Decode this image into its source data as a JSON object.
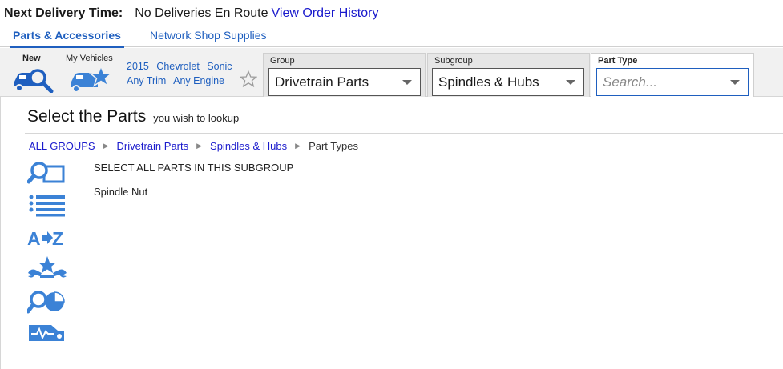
{
  "delivery": {
    "label": "Next Delivery Time:",
    "status": "No Deliveries En Route",
    "history_link": "View Order History"
  },
  "tabs": [
    {
      "label": "Parts & Accessories",
      "active": true
    },
    {
      "label": "Network Shop Supplies",
      "active": false
    }
  ],
  "toolbar": {
    "new_label": "New",
    "my_vehicles_label": "My Vehicles",
    "vehicle": {
      "year": "2015",
      "make": "Chevrolet",
      "model": "Sonic",
      "trim": "Any Trim",
      "engine": "Any Engine"
    },
    "group": {
      "label": "Group",
      "value": "Drivetrain Parts"
    },
    "subgroup": {
      "label": "Subgroup",
      "value": "Spindles & Hubs"
    },
    "part_type": {
      "label": "Part Type",
      "placeholder": "Search..."
    }
  },
  "main": {
    "title": "Select the Parts",
    "subtitle": "you wish to lookup",
    "breadcrumb": [
      "ALL GROUPS",
      "Drivetrain Parts",
      "Spindles & Hubs",
      "Part Types"
    ],
    "breadcrumb_separator": "▶",
    "parts": [
      "SELECT ALL PARTS IN THIS SUBGROUP",
      "Spindle Nut"
    ],
    "side_icons": [
      "magnify-square-icon",
      "list-icon",
      "a-to-z-icon",
      "tools-star-icon",
      "magnify-pie-icon",
      "car-diagnostic-icon"
    ]
  },
  "colors": {
    "accent": "#1f5fbf",
    "link": "#1a1acc",
    "icon": "#3b82d6",
    "toolbar_bg": "#f1f1f1"
  }
}
